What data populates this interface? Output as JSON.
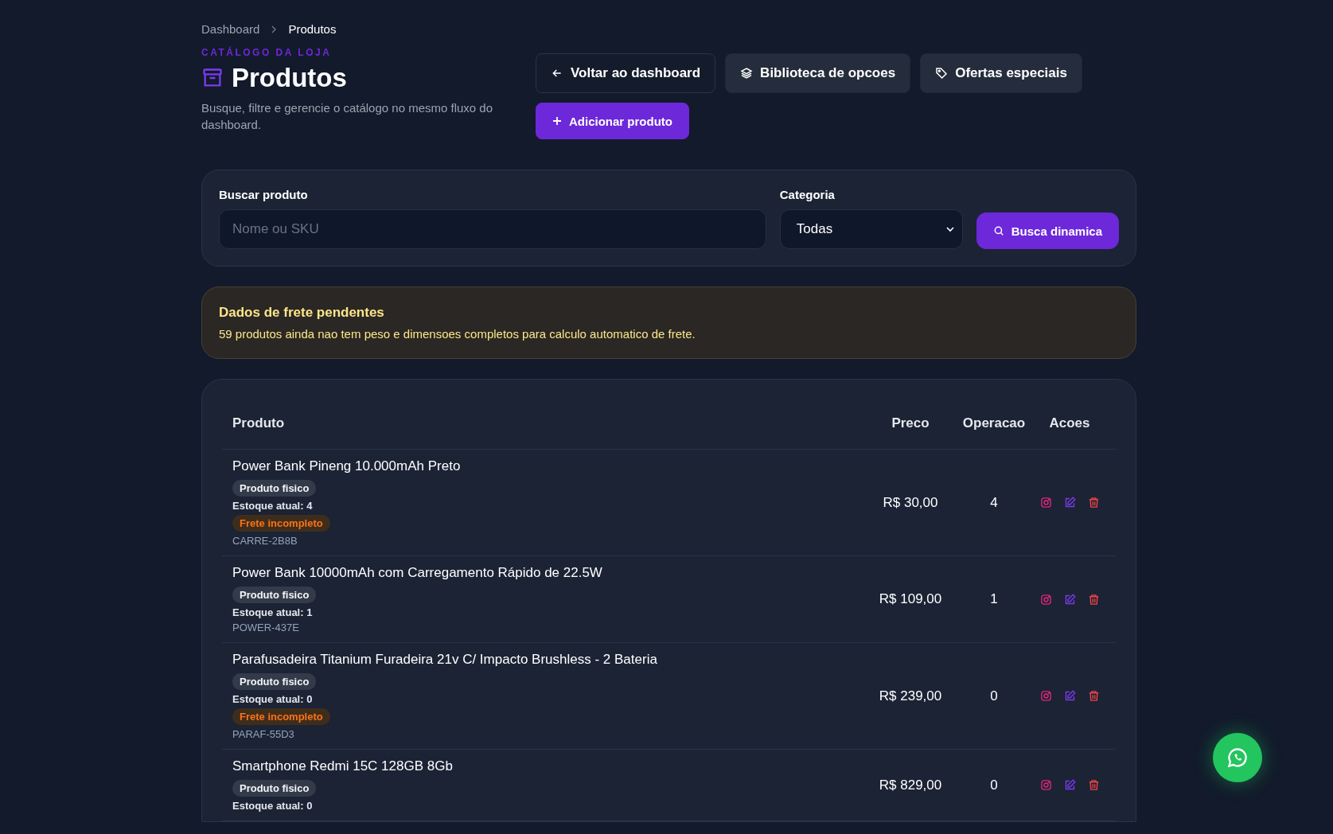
{
  "breadcrumb": [
    {
      "label": "Dashboard",
      "selected": false
    },
    {
      "label": "Produtos",
      "selected": true
    }
  ],
  "header": {
    "eyebrow": "CATÁLOGO DA LOJA",
    "title": "Produtos",
    "subtitle": "Busque, filtre e gerencie o catálogo no mesmo fluxo do dashboard."
  },
  "actions": [
    {
      "label": "Voltar ao dashboard",
      "kind": "back"
    },
    {
      "label": "Biblioteca de opcoes",
      "kind": "library"
    },
    {
      "label": "Ofertas especiais",
      "kind": "offers"
    },
    {
      "label": "Adicionar produto",
      "kind": "add"
    }
  ],
  "filters": {
    "search_label": "Buscar produto",
    "search_placeholder": "Nome ou SKU",
    "category_label": "Categoria",
    "category_value": "Todas",
    "button": "Busca dinamica"
  },
  "alert": {
    "title": "Dados de frete pendentes",
    "text": "59 produtos ainda nao tem peso e dimensoes completos para calculo automatico de frete."
  },
  "table": {
    "columns": [
      "Produto",
      "Preco",
      "Operacao",
      "Acoes"
    ],
    "rows": [
      {
        "name": "Power Bank Pineng 10.000mAh Preto",
        "tag": "Produto fisico",
        "stock": "Estoque atual: 4",
        "freight_incomplete": true,
        "freight_label": "Frete incompleto",
        "sku": "CARRE-2B8B",
        "price": "R$ 30,00",
        "operation": "4"
      },
      {
        "name": "Power Bank 10000mAh com Carregamento Rápido de 22.5W",
        "tag": "Produto fisico",
        "stock": "Estoque atual: 1",
        "freight_incomplete": false,
        "sku": "POWER-437E",
        "price": "R$ 109,00",
        "operation": "1"
      },
      {
        "name": "Parafusadeira Titanium Furadeira 21v C/ Impacto Brushless - 2 Bateria",
        "tag": "Produto fisico",
        "stock": "Estoque atual: 0",
        "freight_incomplete": true,
        "freight_label": "Frete incompleto",
        "sku": "PARAF-55D3",
        "price": "R$ 239,00",
        "operation": "0"
      },
      {
        "name": "Smartphone Redmi 15C 128GB 8Gb",
        "tag": "Produto fisico",
        "stock": "Estoque atual: 0",
        "freight_incomplete": false,
        "price": "R$ 829,00",
        "operation": "0"
      }
    ]
  }
}
